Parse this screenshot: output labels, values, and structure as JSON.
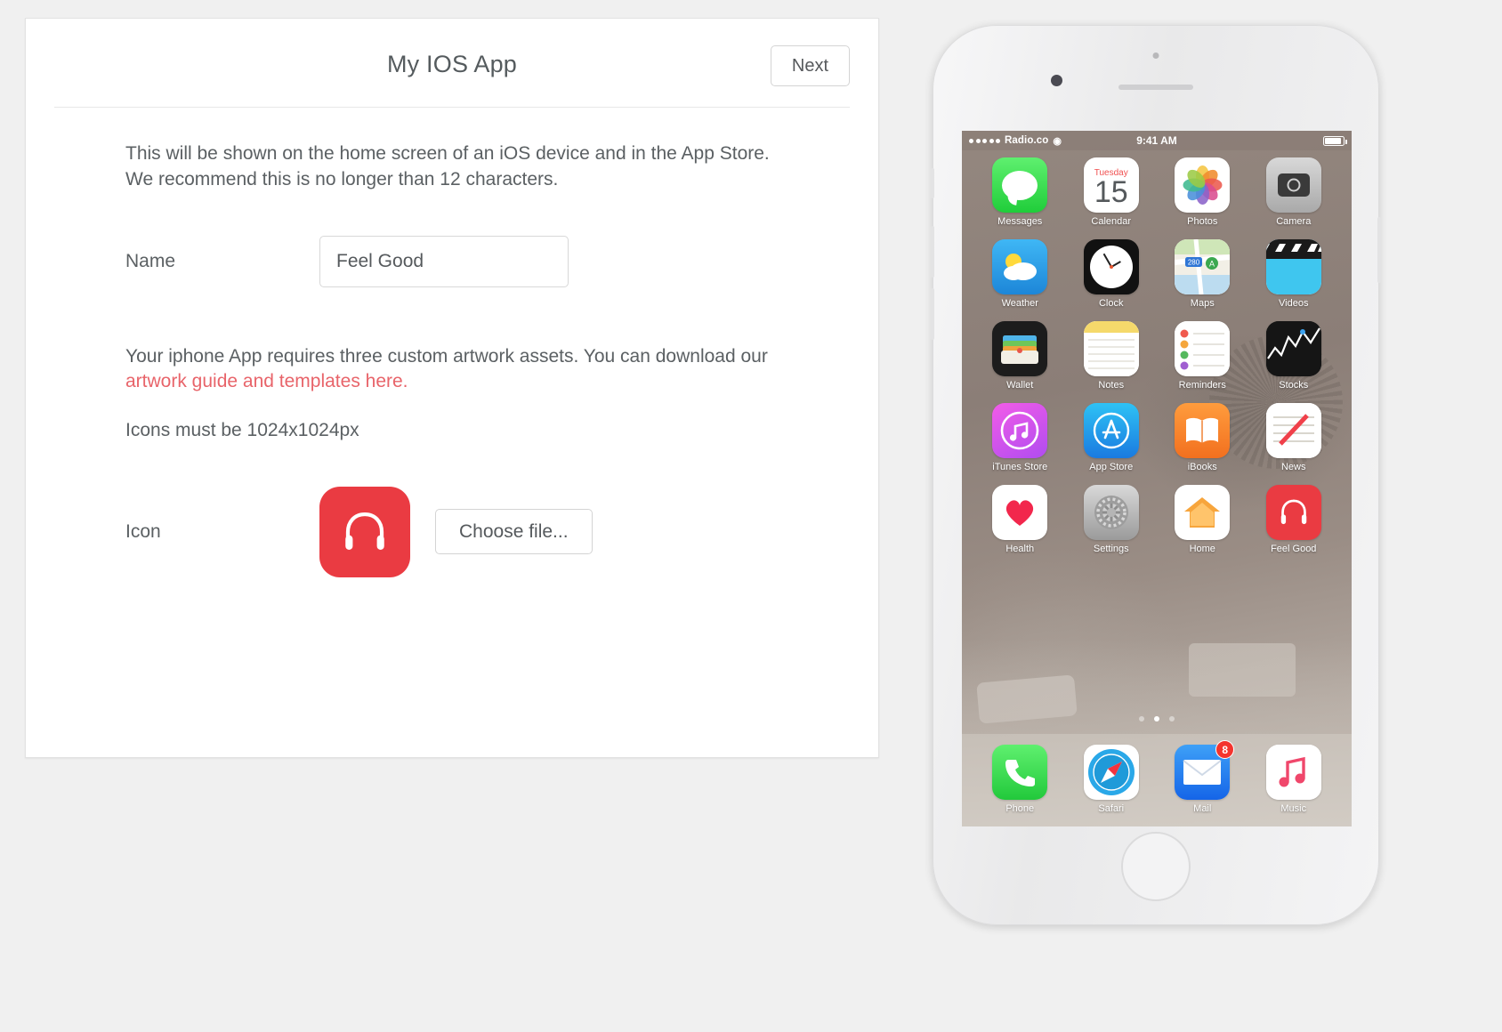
{
  "form": {
    "title": "My IOS App",
    "next_label": "Next",
    "intro_line1": "This will be shown on the home screen of an iOS device and in the App Store.",
    "intro_line2": "We recommend this is no longer than 12 characters.",
    "name_label": "Name",
    "name_value": "Feel Good",
    "name_placeholder": "Feel Good",
    "artwork_text_before": "Your iphone App requires three custom artwork assets. You can download our",
    "artwork_link": "artwork guide and templates here.",
    "icon_size_note": "Icons must be 1024x1024px",
    "icon_label": "Icon",
    "choose_file_label": "Choose file...",
    "link_color": "#e8646a",
    "icon_color": "#ea3b42"
  },
  "phone": {
    "status": {
      "carrier": "Radio.co",
      "time": "9:41 AM",
      "signal_dots": 5,
      "wifi_icon": "wifi-icon",
      "battery_icon": "battery-icon"
    },
    "rows": [
      [
        {
          "label": "Messages",
          "icon": "messages-icon"
        },
        {
          "label": "Calendar",
          "icon": "calendar-icon",
          "day": "Tuesday",
          "date": "15"
        },
        {
          "label": "Photos",
          "icon": "photos-icon"
        },
        {
          "label": "Camera",
          "icon": "camera-icon"
        }
      ],
      [
        {
          "label": "Weather",
          "icon": "weather-icon"
        },
        {
          "label": "Clock",
          "icon": "clock-icon"
        },
        {
          "label": "Maps",
          "icon": "maps-icon",
          "badge_text": "280"
        },
        {
          "label": "Videos",
          "icon": "videos-icon"
        }
      ],
      [
        {
          "label": "Wallet",
          "icon": "wallet-icon"
        },
        {
          "label": "Notes",
          "icon": "notes-icon"
        },
        {
          "label": "Reminders",
          "icon": "reminders-icon"
        },
        {
          "label": "Stocks",
          "icon": "stocks-icon"
        }
      ],
      [
        {
          "label": "iTunes Store",
          "icon": "itunes-store-icon"
        },
        {
          "label": "App Store",
          "icon": "app-store-icon"
        },
        {
          "label": "iBooks",
          "icon": "ibooks-icon"
        },
        {
          "label": "News",
          "icon": "news-icon"
        }
      ],
      [
        {
          "label": "Health",
          "icon": "health-icon"
        },
        {
          "label": "Settings",
          "icon": "settings-icon"
        },
        {
          "label": "Home",
          "icon": "home-icon"
        },
        {
          "label": "Feel Good",
          "icon": "feel-good-icon"
        }
      ]
    ],
    "dock": [
      {
        "label": "Phone",
        "icon": "phone-icon"
      },
      {
        "label": "Safari",
        "icon": "safari-icon"
      },
      {
        "label": "Mail",
        "icon": "mail-icon",
        "badge": "8"
      },
      {
        "label": "Music",
        "icon": "music-icon"
      }
    ],
    "page_dots": {
      "count": 3,
      "active_index": 1
    }
  }
}
